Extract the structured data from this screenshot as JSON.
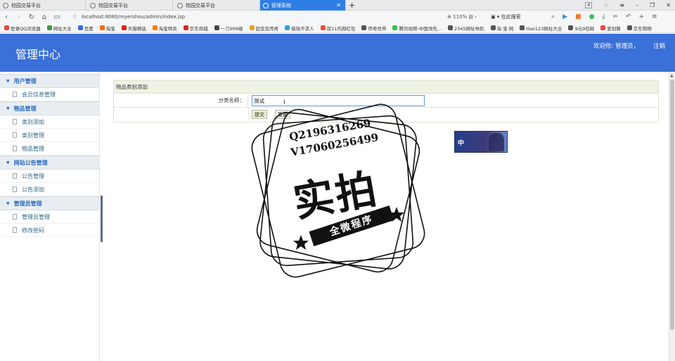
{
  "browser": {
    "tabs": [
      {
        "title": "校园交易平台",
        "active": false
      },
      {
        "title": "校园交易平台",
        "active": false
      },
      {
        "title": "校园交易平台",
        "active": false
      },
      {
        "title": "管理系统",
        "active": true
      }
    ],
    "tab_count": "4",
    "url": "localhost:8080/myershou/admin/index.jsp",
    "zoom": "110%",
    "search_placeholder": "在此搜索",
    "bookmarks": [
      {
        "label": "登录QQ浏览器",
        "color": "#e84b3c"
      },
      {
        "label": "网址大全",
        "color": "#3c9a41"
      },
      {
        "label": "百度",
        "color": "#2f6ee6"
      },
      {
        "label": "淘宝",
        "color": "#ff6a00"
      },
      {
        "label": "天猫精选",
        "color": "#d8281f"
      },
      {
        "label": "淘宝特卖",
        "color": "#ff7a00"
      },
      {
        "label": "京东商城",
        "color": "#d8281f"
      },
      {
        "label": "一刀999级",
        "color": "#444444"
      },
      {
        "label": "超变态传奇",
        "color": "#e3a21a"
      },
      {
        "label": "借钱不求人",
        "color": "#2f9ee6"
      },
      {
        "label": "双11内部红包",
        "color": "#e84b3c"
      },
      {
        "label": "传奇世界",
        "color": "#555555"
      },
      {
        "label": "腾讯视频-中国领先...",
        "color": "#3ebd55"
      },
      {
        "label": "2345网址导航",
        "color": "#555555"
      },
      {
        "label": "淘 宝 网",
        "color": "#555555"
      },
      {
        "label": "Hao123网址大全",
        "color": "#555555"
      },
      {
        "label": "9元9包邮",
        "color": "#555555"
      },
      {
        "label": "爱划算",
        "color": "#e84b3c"
      },
      {
        "label": "京东购物",
        "color": "#555555"
      }
    ]
  },
  "header": {
    "title": "管理中心",
    "welcome": "欢迎你: 管理员，",
    "logout": "注销"
  },
  "sidebar": {
    "groups": [
      {
        "label": "用户管理",
        "items": [
          "会员信息管理"
        ]
      },
      {
        "label": "物品管理",
        "items": [
          "类别添加",
          "类别管理",
          "物品管理"
        ]
      },
      {
        "label": "网站公告管理",
        "items": [
          "公告管理",
          "公告添加"
        ]
      },
      {
        "label": "管理员管理",
        "items": [
          "管理员管理",
          "修改密码"
        ]
      }
    ]
  },
  "form": {
    "title": "物品类别添加",
    "field_label": "分类名称：",
    "field_value": "测试",
    "submit_label": "提交",
    "reset_label": "重置"
  },
  "watermark": {
    "line1": "Q2196316269",
    "line2": "V17060256499",
    "big_text": "实拍",
    "band_text": "全微程序"
  },
  "ad": {
    "label": "中"
  },
  "colors": {
    "header_bg": "#3a70d8",
    "active_tab": "#2f7ee6",
    "sidebar_group_text": "#2a6bc4",
    "form_header_bg": "#eef3e4"
  }
}
